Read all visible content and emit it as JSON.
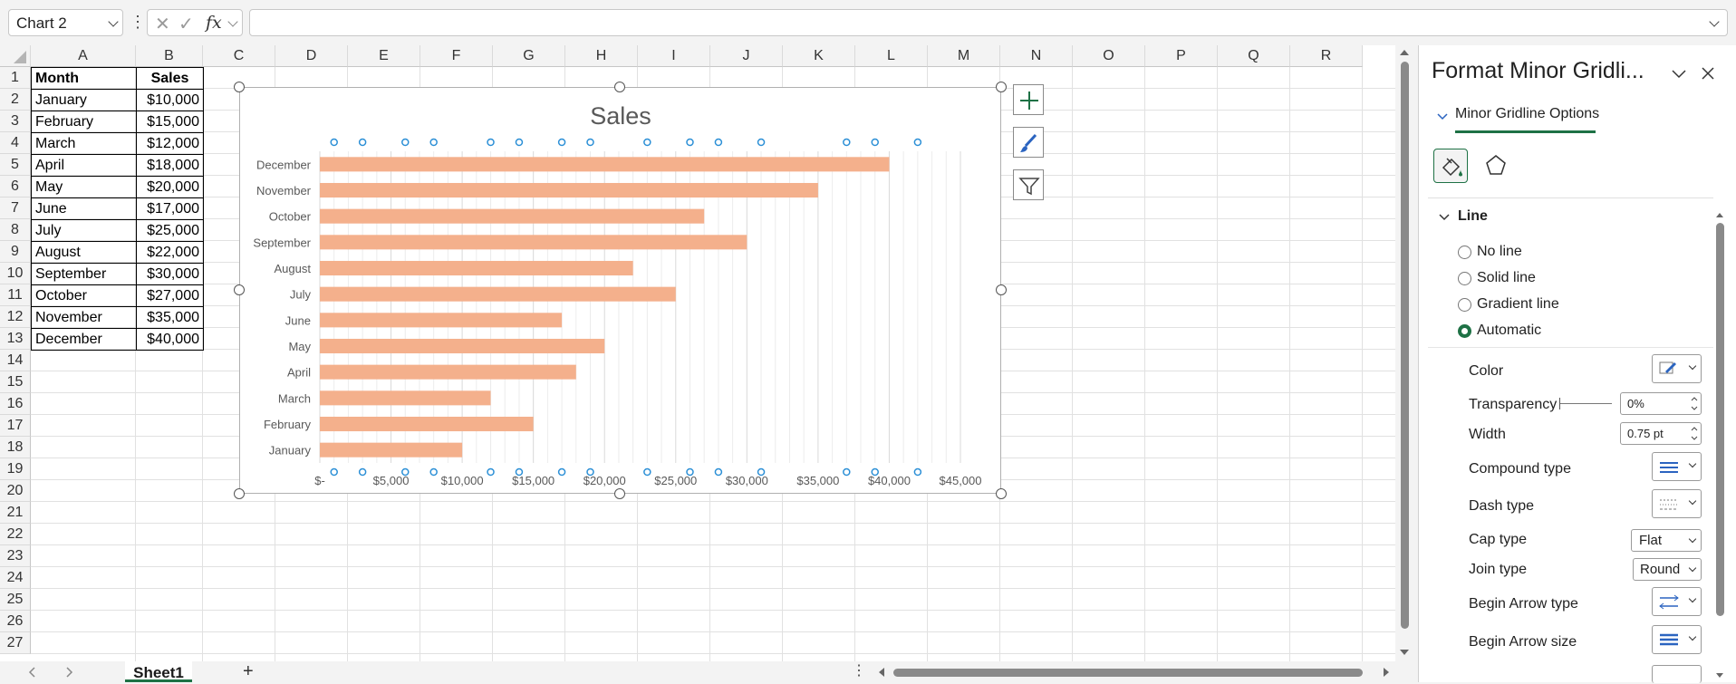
{
  "formula_bar": {
    "name_box": "Chart 2",
    "fx_label": "fx",
    "formula": ""
  },
  "grid": {
    "columns": [
      "A",
      "B",
      "C",
      "D",
      "E",
      "F",
      "G",
      "H",
      "I",
      "J",
      "K",
      "L",
      "M",
      "N",
      "O",
      "P",
      "Q",
      "R"
    ],
    "rows": [
      "1",
      "2",
      "3",
      "4",
      "5",
      "6",
      "7",
      "8",
      "9",
      "10",
      "11",
      "12",
      "13",
      "14",
      "15",
      "16",
      "17",
      "18",
      "19",
      "20",
      "21",
      "22",
      "23",
      "24",
      "25",
      "26",
      "27"
    ],
    "header": {
      "month": "Month",
      "sales": "Sales"
    },
    "data": [
      {
        "month": "January",
        "sales": "$10,000"
      },
      {
        "month": "February",
        "sales": "$15,000"
      },
      {
        "month": "March",
        "sales": "$12,000"
      },
      {
        "month": "April",
        "sales": "$18,000"
      },
      {
        "month": "May",
        "sales": "$20,000"
      },
      {
        "month": "June",
        "sales": "$17,000"
      },
      {
        "month": "July",
        "sales": "$25,000"
      },
      {
        "month": "August",
        "sales": "$22,000"
      },
      {
        "month": "September",
        "sales": "$30,000"
      },
      {
        "month": "October",
        "sales": "$27,000"
      },
      {
        "month": "November",
        "sales": "$35,000"
      },
      {
        "month": "December",
        "sales": "$40,000"
      }
    ]
  },
  "chart_data": {
    "type": "bar",
    "orientation": "horizontal",
    "title": "Sales",
    "categories": [
      "January",
      "February",
      "March",
      "April",
      "May",
      "June",
      "July",
      "August",
      "September",
      "October",
      "November",
      "December"
    ],
    "values": [
      10000,
      15000,
      12000,
      18000,
      20000,
      17000,
      25000,
      22000,
      30000,
      27000,
      35000,
      40000
    ],
    "x_ticks": [
      "$-",
      "$5,000",
      "$10,000",
      "$15,000",
      "$20,000",
      "$25,000",
      "$30,000",
      "$35,000",
      "$40,000",
      "$45,000"
    ],
    "xlim": [
      0,
      45000
    ],
    "bar_color": "#f4b08c",
    "minor_gridlines": true,
    "selected_element": "minor gridlines"
  },
  "sheet": {
    "tab": "Sheet1",
    "add": "+"
  },
  "pane": {
    "title": "Format Minor Gridli...",
    "subtitle": "Minor Gridline Options",
    "section": "Line",
    "options": [
      {
        "label": "No line",
        "selected": false
      },
      {
        "label": "Solid line",
        "selected": false
      },
      {
        "label": "Gradient line",
        "selected": false
      },
      {
        "label": "Automatic",
        "selected": true
      }
    ],
    "props": {
      "color": "Color",
      "transparency": "Transparency",
      "transparency_value": "0%",
      "width": "Width",
      "width_value": "0.75 pt",
      "compound": "Compound type",
      "dash": "Dash type",
      "cap": "Cap type",
      "cap_value": "Flat",
      "join": "Join type",
      "join_value": "Round",
      "begin_arrow_type": "Begin Arrow type",
      "begin_arrow_size": "Begin Arrow size"
    },
    "accent": "#1e7145"
  }
}
